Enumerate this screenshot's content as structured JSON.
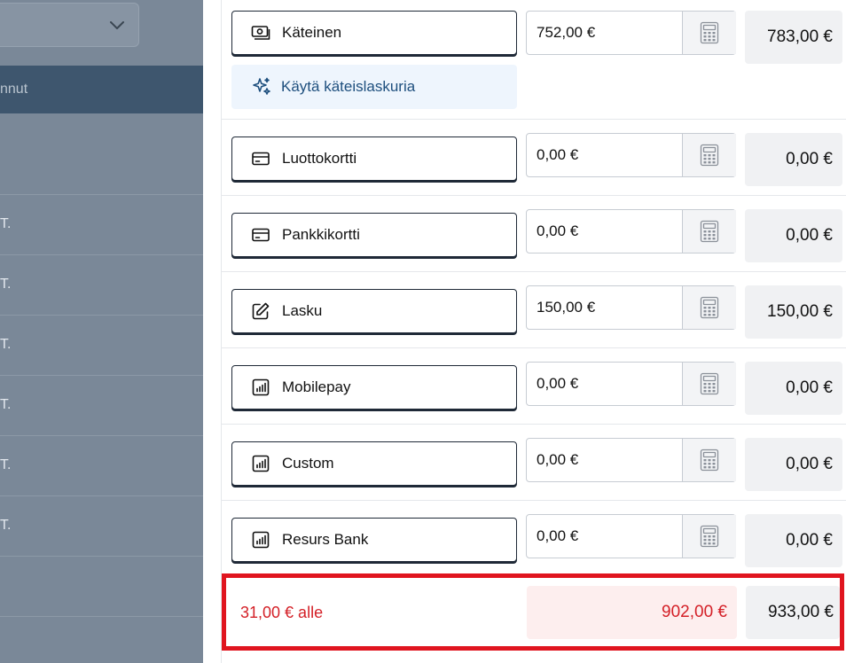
{
  "background": {
    "header_label": "nnut",
    "row_labels": [
      "T.",
      "T.",
      "T.",
      "T.",
      "T.",
      "T."
    ]
  },
  "methods": [
    {
      "label": "Käteinen",
      "icon": "cash-icon",
      "amount": "752,00 €",
      "total": "783,00 €"
    },
    {
      "label": "Luottokortti",
      "icon": "credit-card-icon",
      "amount": "0,00 €",
      "total": "0,00 €"
    },
    {
      "label": "Pankkikortti",
      "icon": "debit-card-icon",
      "amount": "0,00 €",
      "total": "0,00 €"
    },
    {
      "label": "Lasku",
      "icon": "edit-icon",
      "amount": "150,00 €",
      "total": "150,00 €"
    },
    {
      "label": "Mobilepay",
      "icon": "chart-icon",
      "amount": "0,00 €",
      "total": "0,00 €"
    },
    {
      "label": "Custom",
      "icon": "chart-icon",
      "amount": "0,00 €",
      "total": "0,00 €"
    },
    {
      "label": "Resurs Bank",
      "icon": "chart-icon",
      "amount": "0,00 €",
      "total": "0,00 €"
    }
  ],
  "cash_calculator": {
    "label": "Käytä käteislaskuria",
    "icon": "sparkles-icon"
  },
  "summary": {
    "difference": "31,00 € alle",
    "entered_total": "902,00 €",
    "expected_total": "933,00 €"
  },
  "colors": {
    "accent_blue": "#1e4f7e",
    "error_red": "#d42027",
    "highlight_border": "#e0151f"
  }
}
